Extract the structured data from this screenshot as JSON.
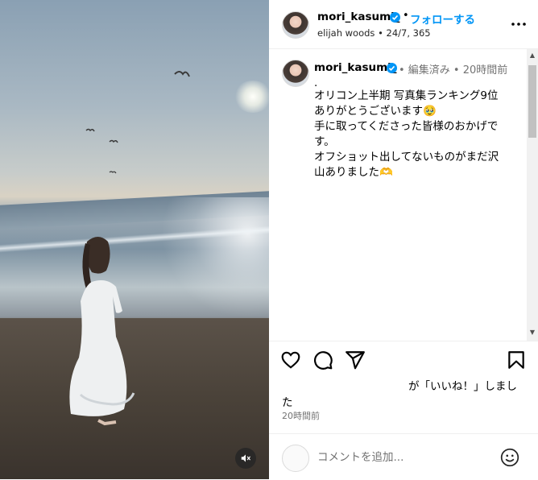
{
  "post": {
    "username": "mori_kasumi_",
    "separator": "•",
    "follow_label": "フォローする",
    "subtitle": "elijah woods • 24/7, 365",
    "more_icon": "more-horizontal-icon"
  },
  "caption": {
    "username": "mori_kasumi_",
    "meta": "• 編集済み • 20時間前",
    "lines": [
      ".",
      "オリコン上半期 写真集ランキング9位",
      "ありがとうございます🥹",
      "手に取ってくださった皆様のおかげで",
      "す。",
      "オフショット出してないものがまだ沢",
      "山ありました🫶"
    ]
  },
  "actions": {
    "like_icon": "heart-icon",
    "comment_icon": "comment-bubble-icon",
    "share_icon": "send-icon",
    "save_icon": "bookmark-icon"
  },
  "likes": {
    "line1": "が「いいね！」しまし",
    "line2": "た"
  },
  "timestamp": "20時間前",
  "comment": {
    "placeholder": "コメントを追加...",
    "emoji_icon": "emoji-smile-icon"
  },
  "media": {
    "mute_icon": "speaker-muted-icon"
  },
  "colors": {
    "accent": "#0095f6",
    "secondary_text": "#737373",
    "divider": "#efefef"
  }
}
